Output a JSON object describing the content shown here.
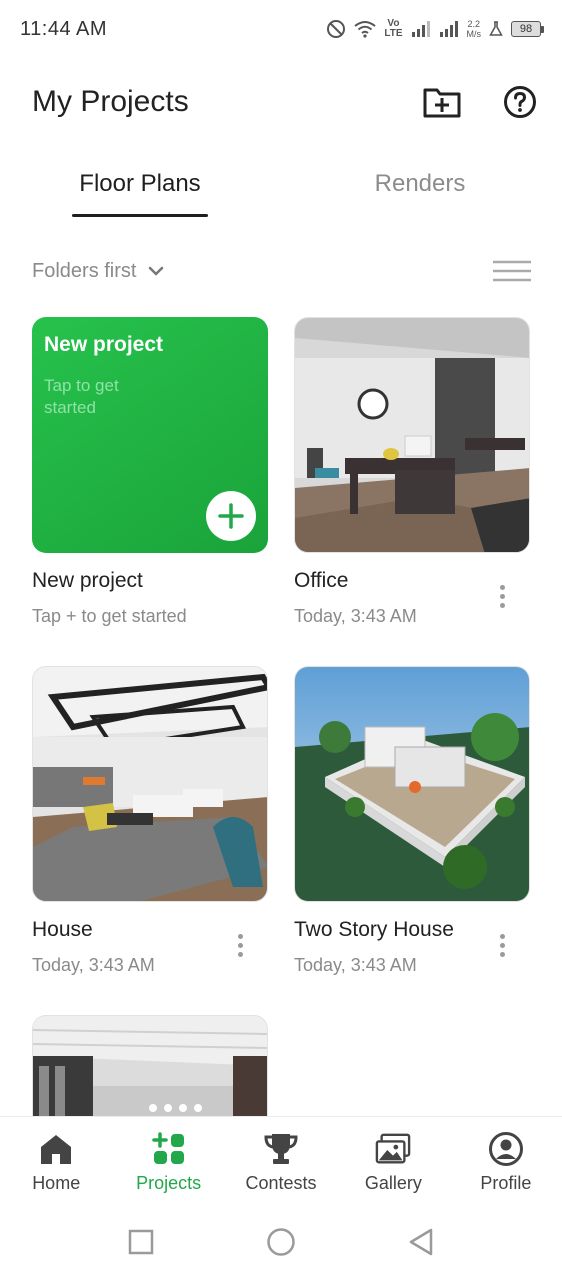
{
  "status_bar": {
    "time": "11:44 AM",
    "network_label_top": "Vo",
    "network_label_bottom": "LTE",
    "speed_value": "2.2",
    "speed_unit": "M/s",
    "battery": "98"
  },
  "header": {
    "title": "My Projects",
    "new_folder_icon": "folder-plus-icon",
    "help_icon": "help-icon"
  },
  "tabs": [
    {
      "label": "Floor Plans",
      "active": true
    },
    {
      "label": "Renders",
      "active": false
    }
  ],
  "sort": {
    "label": "Folders first",
    "view_icon": "list-view-icon"
  },
  "new_project_card": {
    "thumb_title": "New project",
    "thumb_hint": "Tap to get started",
    "title": "New project",
    "subtitle": "Tap + to get started"
  },
  "projects": [
    {
      "title": "Office",
      "subtitle": "Today, 3:43 AM",
      "thumbnail": "office-render"
    },
    {
      "title": "House",
      "subtitle": "Today, 3:43 AM",
      "thumbnail": "living-room-render"
    },
    {
      "title": "Two Story House",
      "subtitle": "Today, 3:43 AM",
      "thumbnail": "two-story-house-render"
    },
    {
      "title": "",
      "subtitle": "",
      "thumbnail": "interior-render-partial"
    }
  ],
  "bottom_nav": [
    {
      "label": "Home",
      "icon": "home-icon",
      "active": false
    },
    {
      "label": "Projects",
      "icon": "projects-icon",
      "active": true
    },
    {
      "label": "Contests",
      "icon": "trophy-icon",
      "active": false
    },
    {
      "label": "Gallery",
      "icon": "gallery-icon",
      "active": false
    },
    {
      "label": "Profile",
      "icon": "profile-icon",
      "active": false
    }
  ],
  "colors": {
    "accent": "#22a84a",
    "new_card": "#21b545",
    "text_primary": "#222222",
    "text_secondary": "#8a8a8a"
  }
}
